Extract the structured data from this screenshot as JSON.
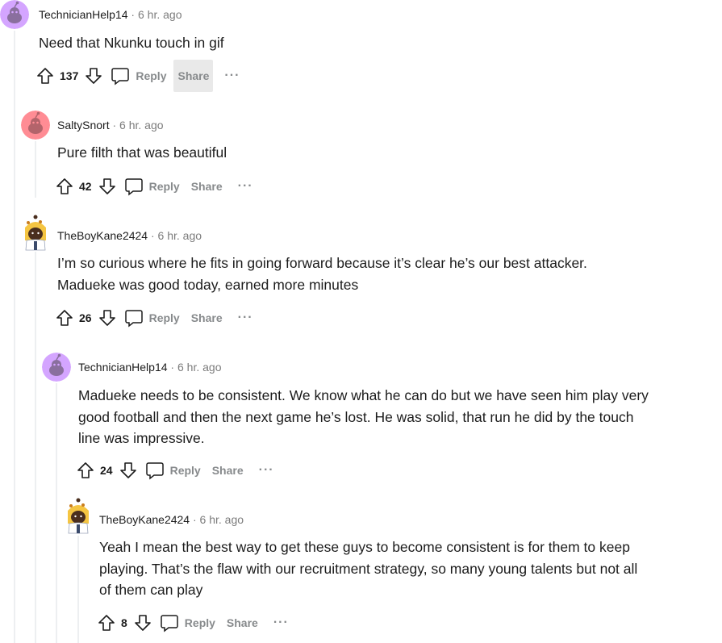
{
  "comments": [
    {
      "author": "TechnicianHelp14",
      "separator": "·",
      "time": "6 hr. ago",
      "body": "Need that Nkunku touch in gif",
      "score": "137",
      "reply_label": "Reply",
      "share_label": "Share",
      "more_label": "···"
    },
    {
      "author": "SaltySnort",
      "separator": "·",
      "time": "6 hr. ago",
      "body": "Pure filth that was beautiful",
      "score": "42",
      "reply_label": "Reply",
      "share_label": "Share",
      "more_label": "···"
    },
    {
      "author": "TheBoyKane2424",
      "separator": "·",
      "time": "6 hr. ago",
      "body_lines": [
        "I’m so curious where he fits in going forward because it’s clear he’s our best attacker.",
        "Madueke was good today, earned more minutes"
      ],
      "score": "26",
      "reply_label": "Reply",
      "share_label": "Share",
      "more_label": "···"
    },
    {
      "author": "TechnicianHelp14",
      "separator": "·",
      "time": "6 hr. ago",
      "body_lines": [
        "Madueke needs to be consistent. We know what he can do but we have seen him play very",
        "good football and then the next game he’s lost. He was solid, that run he did by the touch",
        "line was impressive."
      ],
      "score": "24",
      "reply_label": "Reply",
      "share_label": "Share",
      "more_label": "···"
    },
    {
      "author": "TheBoyKane2424",
      "separator": "·",
      "time": "6 hr. ago",
      "body_lines": [
        "Yeah I mean the best way to get these guys to become consistent is for them to keep",
        "playing. That’s the flaw with our recruitment strategy, so many young talents but not all",
        "of them can play"
      ],
      "score": "8",
      "reply_label": "Reply",
      "share_label": "Share",
      "more_label": "···"
    }
  ],
  "colors": {
    "avatar_purple": "#d4a5ff",
    "avatar_pink": "#ff8c94",
    "meta_gray": "#7c7c7c",
    "action_gray": "#878a8c"
  }
}
